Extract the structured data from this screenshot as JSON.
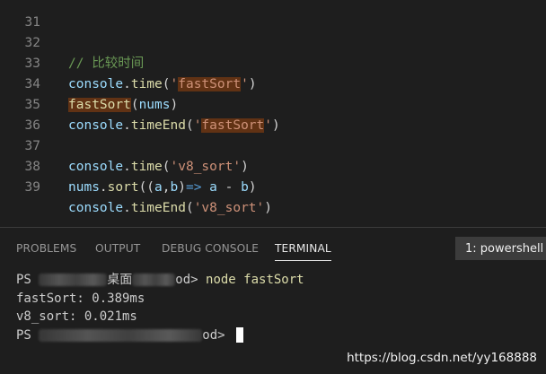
{
  "editor": {
    "lines": [
      {
        "num": "31"
      },
      {
        "num": "32",
        "comment": "// 比较时间"
      },
      {
        "num": "33",
        "obj": "console",
        "dot": ".",
        "method": "time",
        "open": "(",
        "q1": "'",
        "arg": "fastSort",
        "q2": "'",
        "close": ")"
      },
      {
        "num": "34",
        "fn": "fastSort",
        "open": "(",
        "arg": "nums",
        "close": ")"
      },
      {
        "num": "35",
        "obj": "console",
        "dot": ".",
        "method": "timeEnd",
        "open": "(",
        "q1": "'",
        "arg": "fastSort",
        "q2": "'",
        "close": ")"
      },
      {
        "num": "36"
      },
      {
        "num": "37",
        "obj": "console",
        "dot": ".",
        "method": "time",
        "open": "(",
        "str": "'v8_sort'",
        "close": ")"
      },
      {
        "num": "38",
        "obj": "nums",
        "dot": ".",
        "method": "sort",
        "open": "((",
        "a": "a",
        "comma": ",",
        "b": "b",
        "close1": ")",
        "arrow": "=>",
        "expr_a": " a",
        "minus": " - ",
        "expr_b": "b",
        "close": ")"
      },
      {
        "num": "39",
        "obj": "console",
        "dot": ".",
        "method": "timeEnd",
        "open": "(",
        "str": "'v8_sort'",
        "close": ")"
      }
    ]
  },
  "panel": {
    "tabs": [
      "PROBLEMS",
      "OUTPUT",
      "DEBUG CONSOLE",
      "TERMINAL"
    ],
    "active_tab": "TERMINAL",
    "terminal_selector": "1: powershell",
    "terminal_lines": {
      "prompt1_start": "PS ",
      "prompt1_mid": "桌面",
      "prompt1_end": "od> ",
      "command": "node fastSort",
      "out1": "fastSort: 0.389ms",
      "out2": "v8_sort: 0.021ms",
      "prompt2_start": "PS ",
      "prompt2_end": "od> "
    }
  },
  "watermark": "https://blog.csdn.net/yy168888",
  "colors": {
    "background": "#1e1e1e",
    "comment": "#6a9955",
    "variable": "#9cdcfe",
    "function": "#dcdcaa",
    "string": "#ce9178",
    "find_highlight": "#613214"
  }
}
